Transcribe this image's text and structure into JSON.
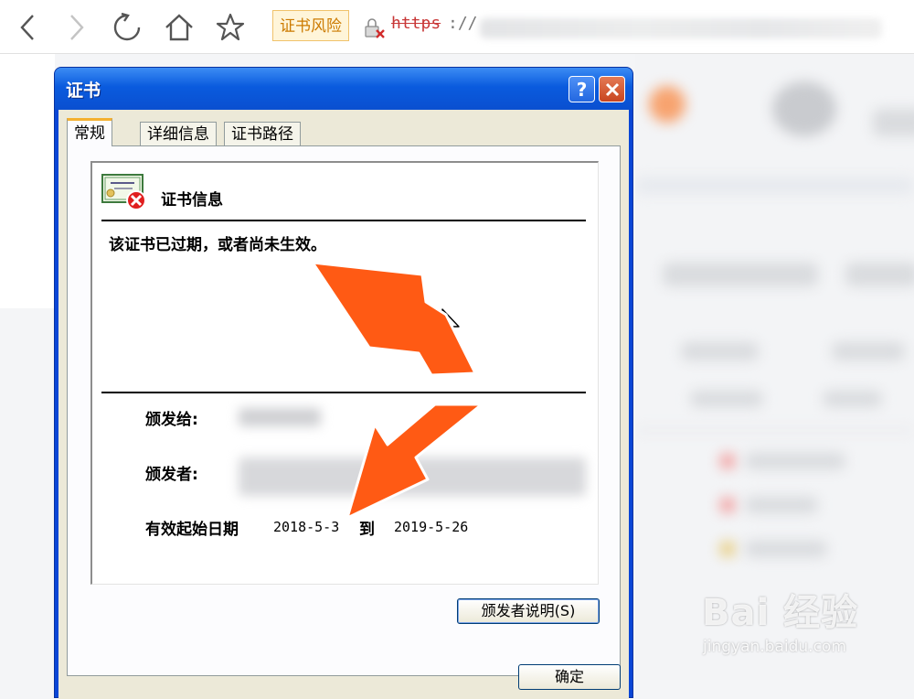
{
  "browser": {
    "nav_icons": [
      "back-icon",
      "forward-icon",
      "refresh-icon",
      "home-icon",
      "star-icon"
    ],
    "risk_badge": "证书风险",
    "url_protocol": "https",
    "url_separator": "://"
  },
  "dialog": {
    "title": "证书",
    "help_symbol": "?",
    "tabs": [
      "常规",
      "详细信息",
      "证书路径"
    ],
    "active_tab": "常规",
    "cert_info_title": "证书信息",
    "status_message": "该证书已过期，或者尚未生效。",
    "issued_to_label": "颁发给:",
    "issued_by_label": "颁发者:",
    "valid_from_label": "有效起始日期",
    "valid_from": "2018-5-3",
    "to_label": "到",
    "valid_to": "2019-5-26",
    "issuer_statement_button": "颁发者说明(S)",
    "ok_button": "确定"
  },
  "watermark": {
    "brand": "Bai 经验",
    "sub": "jingyan.baidu.com"
  },
  "colors": {
    "annotation_arrow": "#ff5a14",
    "xp_titlebar": "#0a5bde",
    "risk_badge_bg": "#fff5d9",
    "risk_badge_text": "#cc7a00",
    "url_protocol": "#c83737"
  }
}
